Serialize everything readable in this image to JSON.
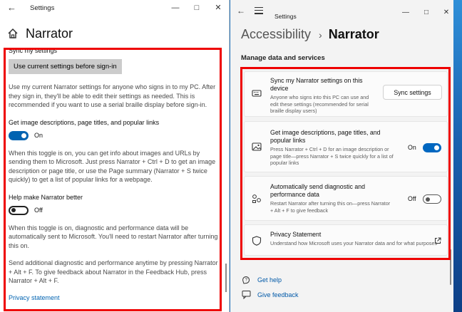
{
  "left_window": {
    "app_title": "Settings",
    "page_title": "Narrator",
    "sync": {
      "heading": "Sync my settings",
      "button_label": "Use current settings before sign-in",
      "description": "Use my current Narrator settings for anyone who signs in to my PC. After they sign in, they'll be able to edit their settings as needed. This is recommended if you want to use a serial braille display before sign-in."
    },
    "image_descriptions": {
      "heading": "Get image descriptions, page titles, and popular links",
      "toggle_state": "On",
      "description": "When this toggle is on, you can get info about images and URLs by sending them to Microsoft. Just press Narrator + Ctrl + D to get an image description or page title, or use the Page summary (Narrator + S twice quickly) to get a list of popular links for a webpage."
    },
    "help_improve": {
      "heading": "Help make Narrator better",
      "toggle_state": "Off",
      "description": "When this toggle is on, diagnostic and performance data will be automatically sent to Microsoft. You'll need to restart Narrator after turning this on.",
      "feedback_text": "Send additional diagnostic and performance anytime by pressing Narrator + Alt + F. To give feedback about Narrator in the Feedback Hub, press Narrator + Alt + F."
    },
    "privacy_link": "Privacy statement"
  },
  "right_window": {
    "app_title": "Settings",
    "breadcrumb_parent": "Accessibility",
    "breadcrumb_separator": "›",
    "breadcrumb_current": "Narrator",
    "section_title": "Manage data and services",
    "cards": [
      {
        "icon": "keyboard-icon",
        "title": "Sync my Narrator settings on this device",
        "description": "Anyone who signs into this PC can use and edit these settings (recommended for serial braille display users)",
        "button_label": "Sync settings"
      },
      {
        "icon": "image-icon",
        "title": "Get image descriptions, page titles, and popular links",
        "description": "Press Narrator + Ctrl + D for an image description or page title—press Narrator + S twice quickly for a list of popular links",
        "toggle_label": "On",
        "toggle_on": true
      },
      {
        "icon": "diagnostics-icon",
        "title": "Automatically send diagnostic and performance data",
        "description": "Restart Narrator after turning this on—press Narrator + Alt + F to give feedback",
        "toggle_label": "Off",
        "toggle_on": false
      },
      {
        "icon": "shield-icon",
        "title": "Privacy Statement",
        "description": "Understand how Microsoft uses your Narrator data and for what purposes"
      }
    ],
    "help_links": {
      "get_help": "Get help",
      "give_feedback": "Give feedback"
    }
  },
  "colors": {
    "highlight": "#ee0000",
    "win10_accent": "#0063b1",
    "win11_accent": "#0067c0",
    "link": "#0059a8"
  }
}
